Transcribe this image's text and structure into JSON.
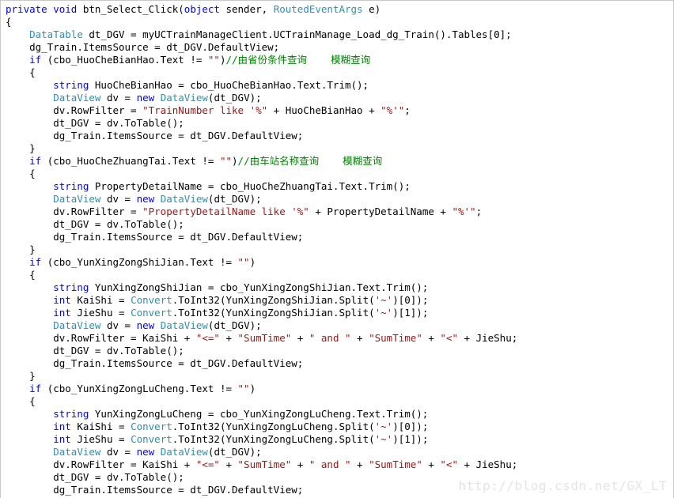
{
  "editor": {
    "language": "C#",
    "colors": {
      "background": "#ffffff",
      "border": "#c8c8c8",
      "keyword": "#0000ff",
      "type": "#2b91af",
      "string": "#a31515",
      "comment": "#008000",
      "plain": "#000000",
      "watermark": "#e4e4e4"
    },
    "watermark": "http://blog.csdn.net/GX_LT",
    "lines": [
      {
        "indent": 0,
        "tokens": [
          {
            "t": "kw",
            "v": "private"
          },
          {
            "t": "plain",
            "v": " "
          },
          {
            "t": "kw",
            "v": "void"
          },
          {
            "t": "plain",
            "v": " btn_Select_Click("
          },
          {
            "t": "kw",
            "v": "object"
          },
          {
            "t": "plain",
            "v": " sender, "
          },
          {
            "t": "type",
            "v": "RoutedEventArgs"
          },
          {
            "t": "plain",
            "v": " e)"
          }
        ]
      },
      {
        "indent": 0,
        "tokens": [
          {
            "t": "plain",
            "v": "{"
          }
        ]
      },
      {
        "indent": 1,
        "tokens": [
          {
            "t": "type",
            "v": "DataTable"
          },
          {
            "t": "plain",
            "v": " dt_DGV = myUCTrainManageClient.UCTrainManage_Load_dg_Train().Tables[0];"
          }
        ]
      },
      {
        "indent": 1,
        "tokens": [
          {
            "t": "plain",
            "v": "dg_Train.ItemsSource = dt_DGV.DefaultView;"
          }
        ]
      },
      {
        "indent": 1,
        "tokens": [
          {
            "t": "kw",
            "v": "if"
          },
          {
            "t": "plain",
            "v": " (cbo_HuoCheBianHao.Text != "
          },
          {
            "t": "str",
            "v": "\"\""
          },
          {
            "t": "plain",
            "v": ")"
          },
          {
            "t": "cmt",
            "v": "//由省份条件查询    模糊查询"
          }
        ]
      },
      {
        "indent": 1,
        "tokens": [
          {
            "t": "plain",
            "v": "{"
          }
        ]
      },
      {
        "indent": 2,
        "tokens": [
          {
            "t": "kw",
            "v": "string"
          },
          {
            "t": "plain",
            "v": " HuoCheBianHao = cbo_HuoCheBianHao.Text.Trim();"
          }
        ]
      },
      {
        "indent": 2,
        "tokens": [
          {
            "t": "type",
            "v": "DataView"
          },
          {
            "t": "plain",
            "v": " dv = "
          },
          {
            "t": "kw",
            "v": "new"
          },
          {
            "t": "plain",
            "v": " "
          },
          {
            "t": "type",
            "v": "DataView"
          },
          {
            "t": "plain",
            "v": "(dt_DGV);"
          }
        ]
      },
      {
        "indent": 2,
        "tokens": [
          {
            "t": "plain",
            "v": "dv.RowFilter = "
          },
          {
            "t": "str",
            "v": "\"TrainNumber like '%\""
          },
          {
            "t": "plain",
            "v": " + HuoCheBianHao + "
          },
          {
            "t": "str",
            "v": "\"%'\""
          },
          {
            "t": "plain",
            "v": ";"
          }
        ]
      },
      {
        "indent": 2,
        "tokens": [
          {
            "t": "plain",
            "v": "dt_DGV = dv.ToTable();"
          }
        ]
      },
      {
        "indent": 2,
        "tokens": [
          {
            "t": "plain",
            "v": "dg_Train.ItemsSource = dt_DGV.DefaultView;"
          }
        ]
      },
      {
        "indent": 1,
        "tokens": [
          {
            "t": "plain",
            "v": "}"
          }
        ]
      },
      {
        "indent": 1,
        "tokens": [
          {
            "t": "kw",
            "v": "if"
          },
          {
            "t": "plain",
            "v": " (cbo_HuoCheZhuangTai.Text != "
          },
          {
            "t": "str",
            "v": "\"\""
          },
          {
            "t": "plain",
            "v": ")"
          },
          {
            "t": "cmt",
            "v": "//由车站名称查询    模糊查询"
          }
        ]
      },
      {
        "indent": 1,
        "tokens": [
          {
            "t": "plain",
            "v": "{"
          }
        ]
      },
      {
        "indent": 2,
        "tokens": [
          {
            "t": "kw",
            "v": "string"
          },
          {
            "t": "plain",
            "v": " PropertyDetailName = cbo_HuoCheZhuangTai.Text.Trim();"
          }
        ]
      },
      {
        "indent": 2,
        "tokens": [
          {
            "t": "type",
            "v": "DataView"
          },
          {
            "t": "plain",
            "v": " dv = "
          },
          {
            "t": "kw",
            "v": "new"
          },
          {
            "t": "plain",
            "v": " "
          },
          {
            "t": "type",
            "v": "DataView"
          },
          {
            "t": "plain",
            "v": "(dt_DGV);"
          }
        ]
      },
      {
        "indent": 2,
        "tokens": [
          {
            "t": "plain",
            "v": "dv.RowFilter = "
          },
          {
            "t": "str",
            "v": "\"PropertyDetailName like '%\""
          },
          {
            "t": "plain",
            "v": " + PropertyDetailName + "
          },
          {
            "t": "str",
            "v": "\"%'\""
          },
          {
            "t": "plain",
            "v": ";"
          }
        ]
      },
      {
        "indent": 2,
        "tokens": [
          {
            "t": "plain",
            "v": "dt_DGV = dv.ToTable();"
          }
        ]
      },
      {
        "indent": 2,
        "tokens": [
          {
            "t": "plain",
            "v": "dg_Train.ItemsSource = dt_DGV.DefaultView;"
          }
        ]
      },
      {
        "indent": 1,
        "tokens": [
          {
            "t": "plain",
            "v": "}"
          }
        ]
      },
      {
        "indent": 1,
        "tokens": [
          {
            "t": "kw",
            "v": "if"
          },
          {
            "t": "plain",
            "v": " (cbo_YunXingZongShiJian.Text != "
          },
          {
            "t": "str",
            "v": "\"\""
          },
          {
            "t": "plain",
            "v": ")"
          }
        ]
      },
      {
        "indent": 1,
        "tokens": [
          {
            "t": "plain",
            "v": "{"
          }
        ]
      },
      {
        "indent": 2,
        "tokens": [
          {
            "t": "kw",
            "v": "string"
          },
          {
            "t": "plain",
            "v": " YunXingZongShiJian = cbo_YunXingZongShiJian.Text.Trim();"
          }
        ]
      },
      {
        "indent": 2,
        "tokens": [
          {
            "t": "kw",
            "v": "int"
          },
          {
            "t": "plain",
            "v": " KaiShi = "
          },
          {
            "t": "type",
            "v": "Convert"
          },
          {
            "t": "plain",
            "v": ".ToInt32(YunXingZongShiJian.Split("
          },
          {
            "t": "str",
            "v": "'~'"
          },
          {
            "t": "plain",
            "v": ")[0]);"
          }
        ]
      },
      {
        "indent": 2,
        "tokens": [
          {
            "t": "kw",
            "v": "int"
          },
          {
            "t": "plain",
            "v": " JieShu = "
          },
          {
            "t": "type",
            "v": "Convert"
          },
          {
            "t": "plain",
            "v": ".ToInt32(YunXingZongShiJian.Split("
          },
          {
            "t": "str",
            "v": "'~'"
          },
          {
            "t": "plain",
            "v": ")[1]);"
          }
        ]
      },
      {
        "indent": 2,
        "tokens": [
          {
            "t": "type",
            "v": "DataView"
          },
          {
            "t": "plain",
            "v": " dv = "
          },
          {
            "t": "kw",
            "v": "new"
          },
          {
            "t": "plain",
            "v": " "
          },
          {
            "t": "type",
            "v": "DataView"
          },
          {
            "t": "plain",
            "v": "(dt_DGV);"
          }
        ]
      },
      {
        "indent": 2,
        "tokens": [
          {
            "t": "plain",
            "v": "dv.RowFilter = KaiShi + "
          },
          {
            "t": "str",
            "v": "\"<=\""
          },
          {
            "t": "plain",
            "v": " + "
          },
          {
            "t": "str",
            "v": "\"SumTime\""
          },
          {
            "t": "plain",
            "v": " + "
          },
          {
            "t": "str",
            "v": "\" and \""
          },
          {
            "t": "plain",
            "v": " + "
          },
          {
            "t": "str",
            "v": "\"SumTime\""
          },
          {
            "t": "plain",
            "v": " + "
          },
          {
            "t": "str",
            "v": "\"<\""
          },
          {
            "t": "plain",
            "v": " + JieShu;"
          }
        ]
      },
      {
        "indent": 2,
        "tokens": [
          {
            "t": "plain",
            "v": "dt_DGV = dv.ToTable();"
          }
        ]
      },
      {
        "indent": 2,
        "tokens": [
          {
            "t": "plain",
            "v": "dg_Train.ItemsSource = dt_DGV.DefaultView;"
          }
        ]
      },
      {
        "indent": 1,
        "tokens": [
          {
            "t": "plain",
            "v": "}"
          }
        ]
      },
      {
        "indent": 1,
        "tokens": [
          {
            "t": "kw",
            "v": "if"
          },
          {
            "t": "plain",
            "v": " (cbo_YunXingZongLuCheng.Text != "
          },
          {
            "t": "str",
            "v": "\"\""
          },
          {
            "t": "plain",
            "v": ")"
          }
        ]
      },
      {
        "indent": 1,
        "tokens": [
          {
            "t": "plain",
            "v": "{"
          }
        ]
      },
      {
        "indent": 2,
        "tokens": [
          {
            "t": "kw",
            "v": "string"
          },
          {
            "t": "plain",
            "v": " YunXingZongLuCheng = cbo_YunXingZongLuCheng.Text.Trim();"
          }
        ]
      },
      {
        "indent": 2,
        "tokens": [
          {
            "t": "kw",
            "v": "int"
          },
          {
            "t": "plain",
            "v": " KaiShi = "
          },
          {
            "t": "type",
            "v": "Convert"
          },
          {
            "t": "plain",
            "v": ".ToInt32(YunXingZongLuCheng.Split("
          },
          {
            "t": "str",
            "v": "'~'"
          },
          {
            "t": "plain",
            "v": ")[0]);"
          }
        ]
      },
      {
        "indent": 2,
        "tokens": [
          {
            "t": "kw",
            "v": "int"
          },
          {
            "t": "plain",
            "v": " JieShu = "
          },
          {
            "t": "type",
            "v": "Convert"
          },
          {
            "t": "plain",
            "v": ".ToInt32(YunXingZongLuCheng.Split("
          },
          {
            "t": "str",
            "v": "'~'"
          },
          {
            "t": "plain",
            "v": ")[1]);"
          }
        ]
      },
      {
        "indent": 2,
        "tokens": [
          {
            "t": "type",
            "v": "DataView"
          },
          {
            "t": "plain",
            "v": " dv = "
          },
          {
            "t": "kw",
            "v": "new"
          },
          {
            "t": "plain",
            "v": " "
          },
          {
            "t": "type",
            "v": "DataView"
          },
          {
            "t": "plain",
            "v": "(dt_DGV);"
          }
        ]
      },
      {
        "indent": 2,
        "tokens": [
          {
            "t": "plain",
            "v": "dv.RowFilter = KaiShi + "
          },
          {
            "t": "str",
            "v": "\"<=\""
          },
          {
            "t": "plain",
            "v": " + "
          },
          {
            "t": "str",
            "v": "\"SumTime\""
          },
          {
            "t": "plain",
            "v": " + "
          },
          {
            "t": "str",
            "v": "\" and \""
          },
          {
            "t": "plain",
            "v": " + "
          },
          {
            "t": "str",
            "v": "\"SumTime\""
          },
          {
            "t": "plain",
            "v": " + "
          },
          {
            "t": "str",
            "v": "\"<\""
          },
          {
            "t": "plain",
            "v": " + JieShu;"
          }
        ]
      },
      {
        "indent": 2,
        "tokens": [
          {
            "t": "plain",
            "v": "dt_DGV = dv.ToTable();"
          }
        ]
      },
      {
        "indent": 2,
        "tokens": [
          {
            "t": "plain",
            "v": "dg_Train.ItemsSource = dt_DGV.DefaultView;"
          }
        ]
      }
    ]
  }
}
